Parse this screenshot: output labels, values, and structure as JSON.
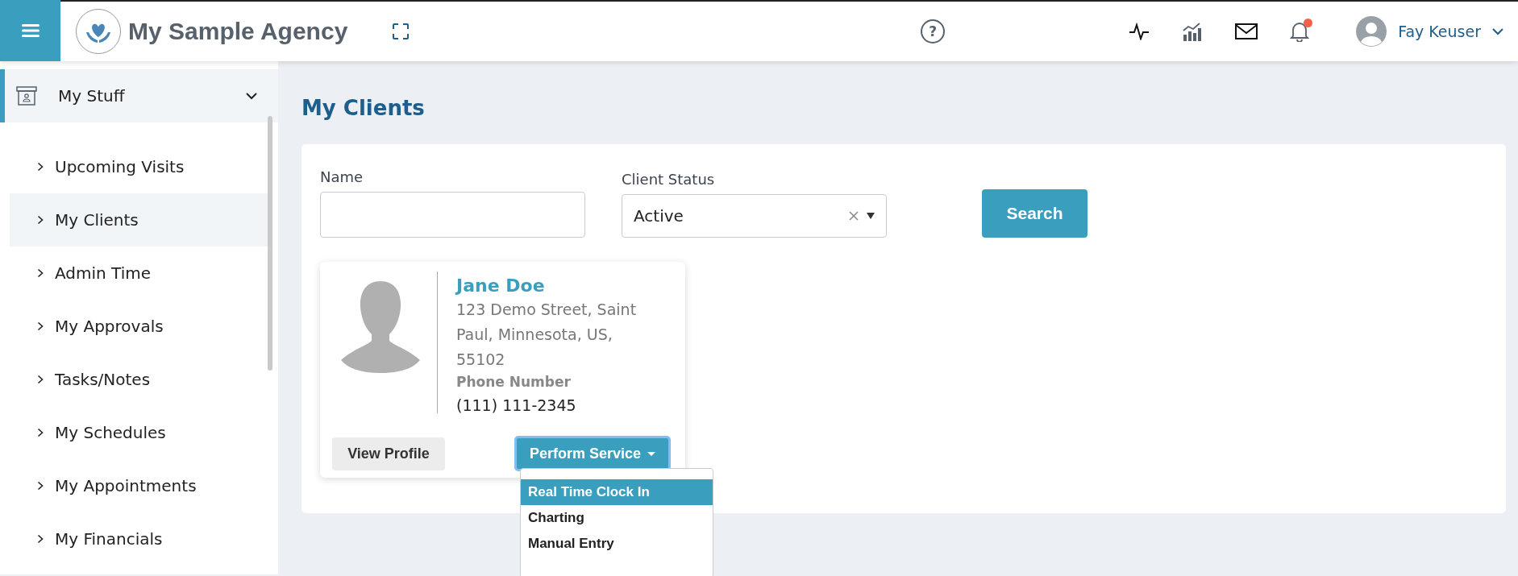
{
  "header": {
    "title": "My Sample Agency",
    "help": "?",
    "user_name": "Fay Keuser",
    "notification_badge": true
  },
  "sidebar": {
    "section": {
      "label": "My Stuff",
      "expanded": true
    },
    "items": [
      {
        "label": "Upcoming Visits",
        "selected": false
      },
      {
        "label": "My Clients",
        "selected": true
      },
      {
        "label": "Admin Time",
        "selected": false
      },
      {
        "label": "My Approvals",
        "selected": false
      },
      {
        "label": "Tasks/Notes",
        "selected": false
      },
      {
        "label": "My Schedules",
        "selected": false
      },
      {
        "label": "My Appointments",
        "selected": false
      },
      {
        "label": "My Financials",
        "selected": false
      }
    ]
  },
  "page": {
    "title": "My Clients"
  },
  "filters": {
    "name": {
      "label": "Name"
    },
    "client_status": {
      "label": "Client Status",
      "value": "Active"
    },
    "search_button": "Search"
  },
  "clients": [
    {
      "name": "Jane Doe",
      "address": "123 Demo Street, Saint Paul, Minnesota, US, 55102",
      "phone_label": "Phone Number",
      "phone": "(111) 111-2345",
      "view_button": "View Profile",
      "service_button": "Perform Service",
      "menu": {
        "open": true,
        "items": [
          {
            "label": "Real Time Clock In",
            "selected": true
          },
          {
            "label": "Charting",
            "selected": false
          },
          {
            "label": "Manual Entry",
            "selected": false
          }
        ]
      }
    }
  ]
}
